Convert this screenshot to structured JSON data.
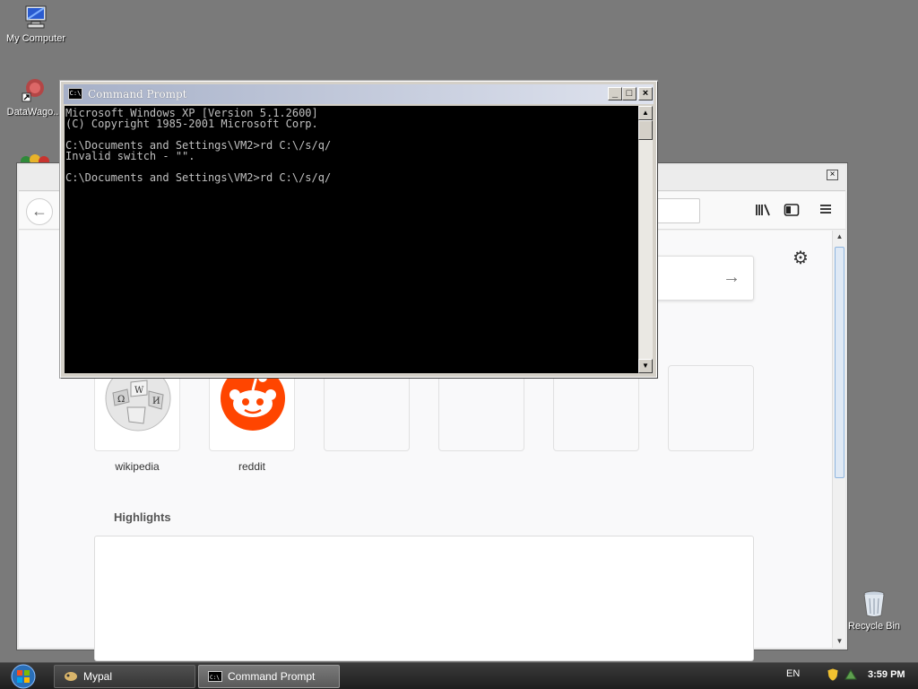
{
  "desktop": {
    "icons": [
      {
        "label": "My Computer"
      },
      {
        "label": "DataWago..."
      },
      {
        "label": "Recycle Bin"
      }
    ]
  },
  "browser": {
    "tiles": [
      {
        "label": "wikipedia"
      },
      {
        "label": "reddit"
      }
    ],
    "highlights_title": "Highlights",
    "close_label": "×"
  },
  "cmd": {
    "title": "Command Prompt",
    "lines": [
      "Microsoft Windows XP [Version 5.1.2600]",
      "(C) Copyright 1985-2001 Microsoft Corp.",
      "",
      "C:\\Documents and Settings\\VM2>rd C:\\/s/q/",
      "Invalid switch - \"\".",
      "",
      "C:\\Documents and Settings\\VM2>rd C:\\/s/q/"
    ],
    "minimize": "_",
    "maximize": "□",
    "close": "×"
  },
  "taskbar": {
    "tasks": [
      {
        "label": "Mypal",
        "active": false
      },
      {
        "label": "Command Prompt",
        "active": true
      }
    ],
    "language": "EN",
    "clock": "3:59 PM"
  },
  "colors": {
    "desktop": "#7a7a7a",
    "reddit": "#ff4500",
    "console_bg": "#000000",
    "console_fg": "#c0c0c0"
  }
}
